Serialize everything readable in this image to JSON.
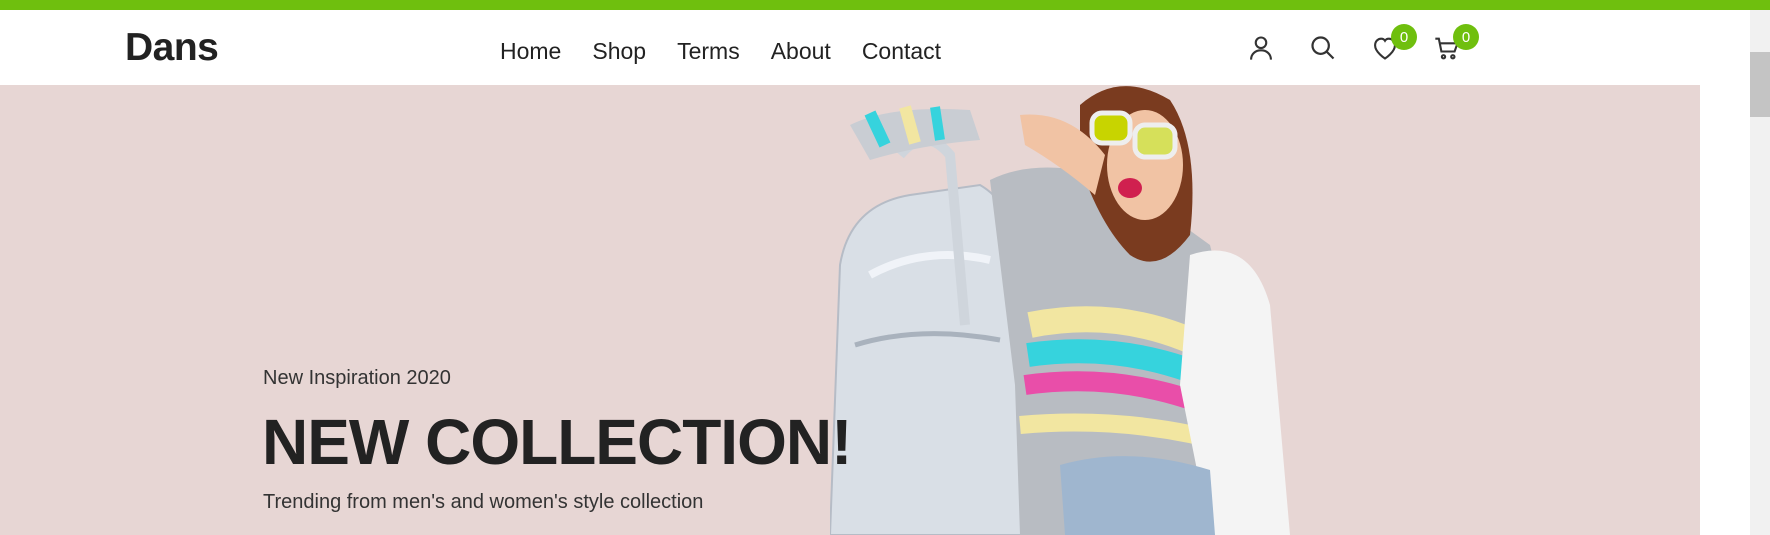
{
  "brand": {
    "name": "Dans",
    "accent": "#6fbf0e"
  },
  "nav": [
    {
      "label": "Home"
    },
    {
      "label": "Shop"
    },
    {
      "label": "Terms"
    },
    {
      "label": "About"
    },
    {
      "label": "Contact"
    }
  ],
  "header_icons": {
    "account": "user-icon",
    "search": "search-icon",
    "wishlist": {
      "icon": "heart-icon",
      "count": "0"
    },
    "cart": {
      "icon": "cart-icon",
      "count": "0"
    }
  },
  "hero": {
    "subtitle": "New Inspiration 2020",
    "title": "NEW COLLECTION!",
    "description": "Trending from men's and women's style collection",
    "background": "#e7d6d4"
  }
}
